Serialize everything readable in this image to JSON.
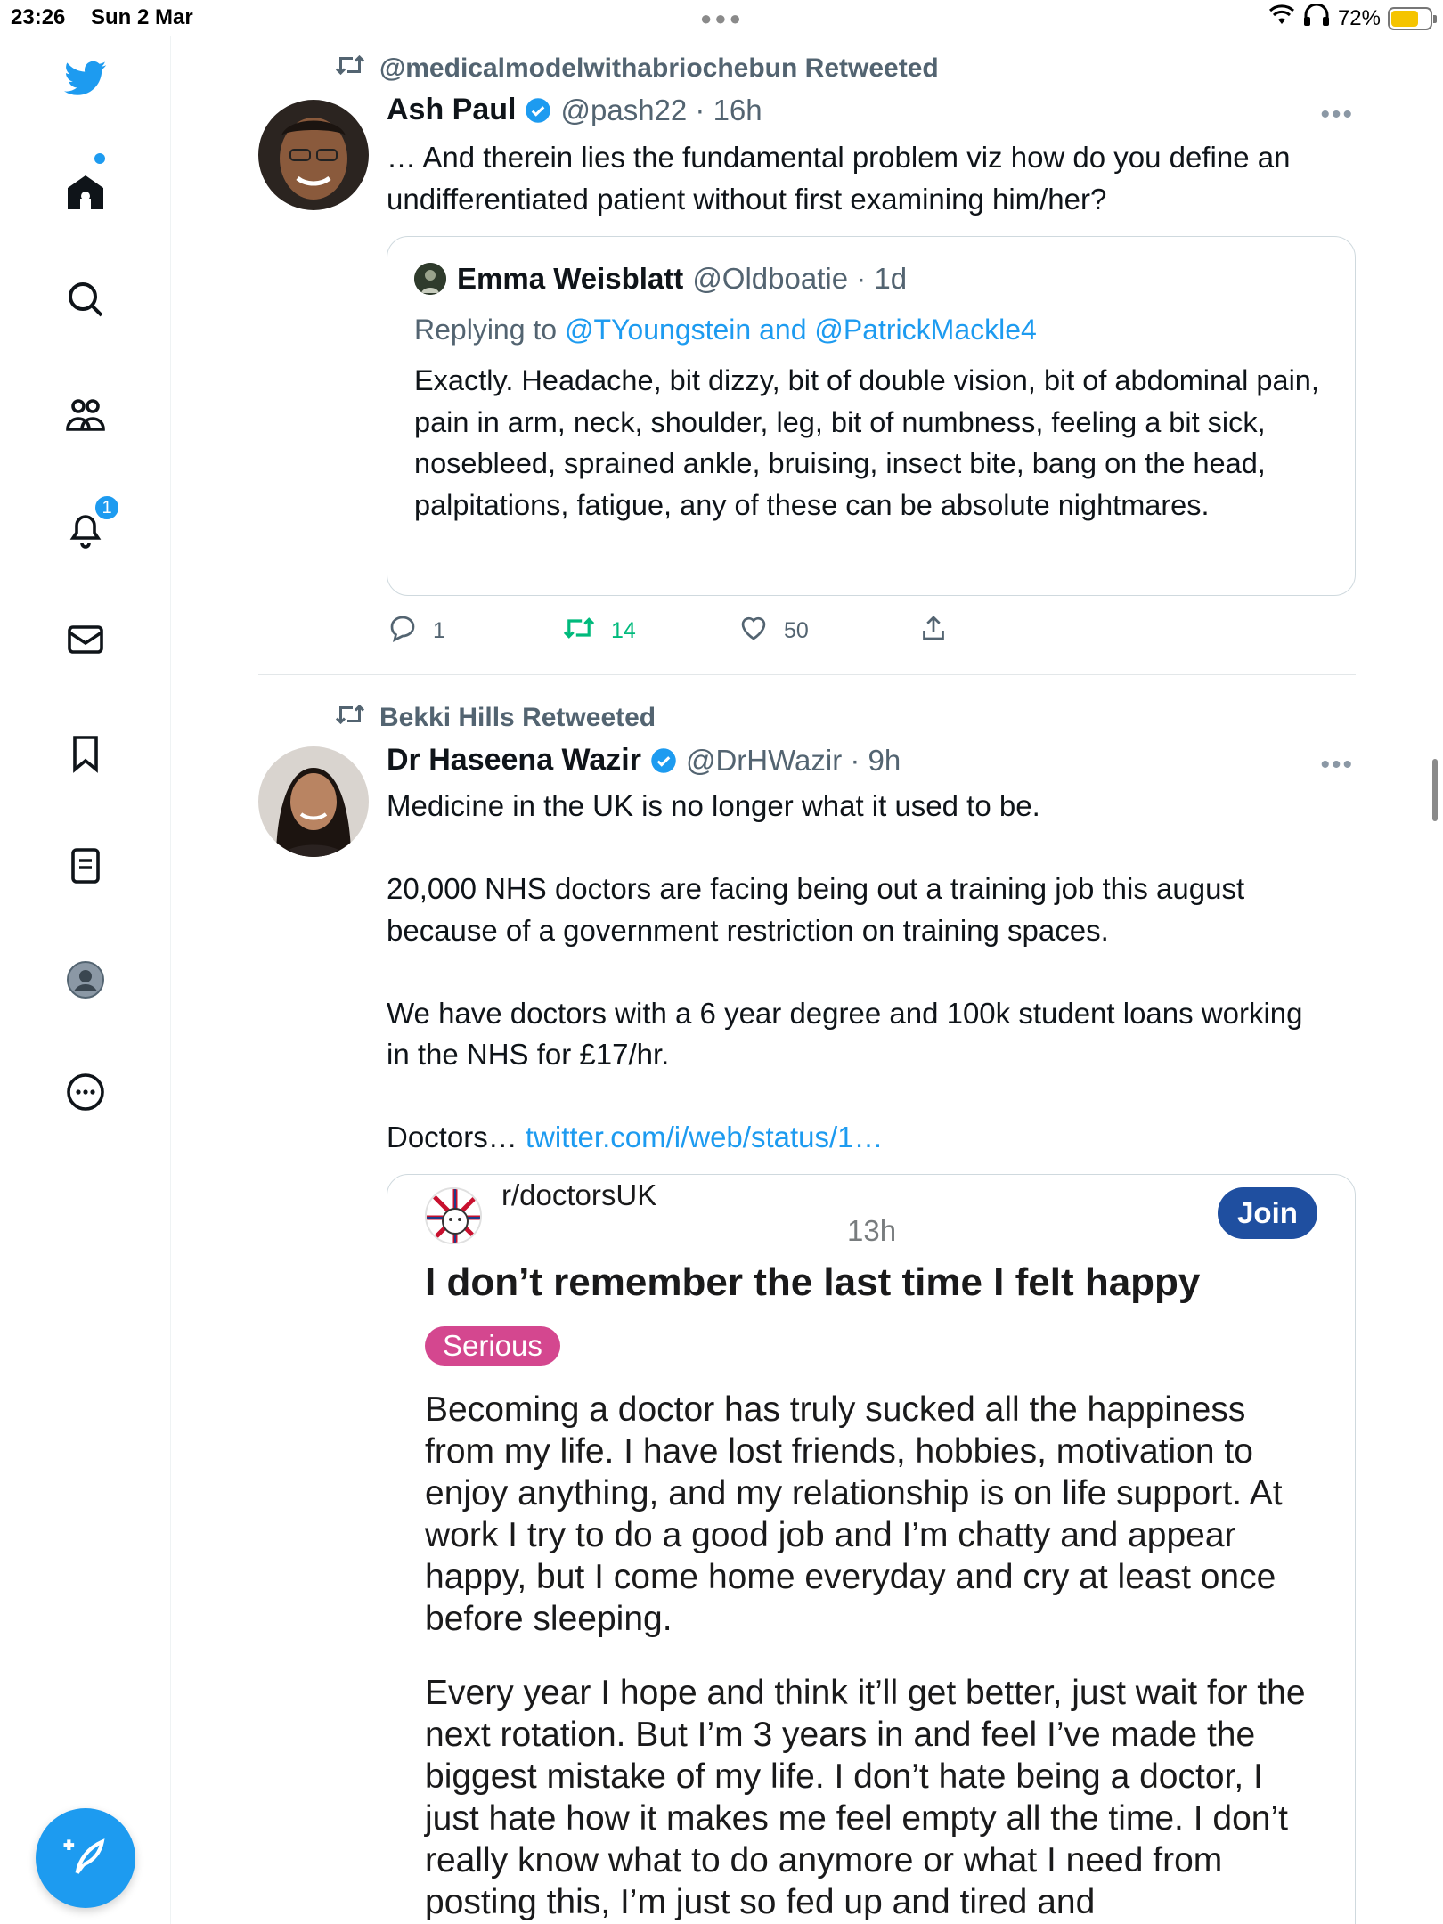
{
  "status_bar": {
    "time": "23:26",
    "date": "Sun 2 Mar",
    "battery": "72%",
    "battery_level": 0.72
  },
  "sidebar": {
    "items": [
      {
        "icon": "twitter-logo-icon"
      },
      {
        "icon": "home-icon",
        "has_dot": true
      },
      {
        "icon": "search-icon"
      },
      {
        "icon": "communities-icon"
      },
      {
        "icon": "notifications-icon",
        "badge": "1"
      },
      {
        "icon": "messages-icon"
      },
      {
        "icon": "bookmarks-icon"
      },
      {
        "icon": "lists-icon"
      },
      {
        "icon": "profile-icon"
      },
      {
        "icon": "more-icon"
      }
    ],
    "compose_icon": "compose-tweet-icon"
  },
  "tweets": [
    {
      "retweeted_by": "@medicalmodelwithabriochebun Retweeted",
      "name": "Ash Paul",
      "handle_time": "@pash22 · 16h",
      "text": "… And therein lies the fundamental problem viz how do you define an undifferentiated patient without first examining him/her?",
      "quote": {
        "name": "Emma Weisblatt",
        "handle_time": "@Oldboatie · 1d",
        "replying_prefix": "Replying to ",
        "replying_to": "@TYoungstein and @PatrickMackle4",
        "text": "Exactly. Headache, bit dizzy, bit of double vision, bit of abdominal pain, pain in arm, neck, shoulder, leg, bit of numbness, feeling a bit sick, nosebleed, sprained ankle, bruising, insect bite, bang on the head, palpitations, fatigue, any of these can be absolute nightmares."
      },
      "replies": "1",
      "retweets": "14",
      "likes": "50"
    },
    {
      "retweeted_by": "Bekki Hills Retweeted",
      "name": "Dr Haseena Wazir",
      "handle_time": "@DrHWazir · 9h",
      "text_part1": "Medicine in the UK is no longer what it used to be.\n\n20,000 NHS doctors are facing being out a training job this august because of a government restriction on training spaces.\n\nWe have doctors with a 6 year degree and 100k student loans working in the NHS for £17/hr.\n\nDoctors… ",
      "link": "twitter.com/i/web/status/1…",
      "reddit_card": {
        "subreddit": "r/doctorsUK",
        "time": "13h",
        "join": "Join",
        "title": "I don’t remember the last time I felt happy",
        "flair": "Serious",
        "paragraph1": "Becoming a doctor has truly sucked all the happiness from my life. I have lost friends, hobbies, motivation to enjoy anything, and my relationship is on life support. At work I try to do a good job and I’m chatty and appear happy, but I come home everyday and cry at least once before sleeping.",
        "paragraph2": "Every year I hope and think it’ll get better, just wait for the next rotation. But I’m 3 years in and feel I’ve made the biggest mistake of my life. I don’t hate being a doctor, I just hate how it makes me feel empty all the time. I don’t really know what to do anymore or what I need from posting this, I’m just so fed up and tired and"
      }
    }
  ],
  "colors": {
    "brand": "#1d9bf0",
    "retweet": "#00ba7c",
    "secondary_text": "#536471",
    "reddit_join": "#1f4fa0",
    "flair": "#d4478f"
  }
}
